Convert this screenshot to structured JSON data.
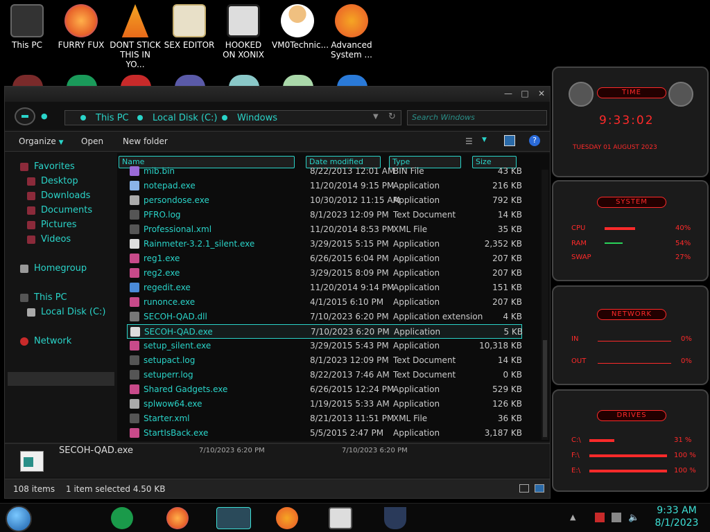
{
  "desktop": {
    "icons": [
      {
        "label": "This PC",
        "color": "#333"
      },
      {
        "label": "FURRY FUX",
        "color": "#e8642a"
      },
      {
        "label": "DONT STICK THIS IN YO...",
        "color": "#f5a623"
      },
      {
        "label": "SEX EDITOR",
        "color": "#c8b070"
      },
      {
        "label": "HOOKED ON XONIX",
        "color": "#888"
      },
      {
        "label": "VM0Technic...",
        "color": "#e89a3a"
      },
      {
        "label": "Advanced System ...",
        "color": "#f07a2a"
      }
    ]
  },
  "explorer": {
    "breadcrumbs": [
      "This PC",
      "Local Disk (C:)",
      "Windows"
    ],
    "search_placeholder": "Search Windows",
    "toolbar": {
      "organize": "Organize",
      "open": "Open",
      "new_folder": "New folder"
    },
    "nav": {
      "favorites": "Favorites",
      "desktop": "Desktop",
      "downloads": "Downloads",
      "documents": "Documents",
      "pictures": "Pictures",
      "videos": "Videos",
      "homegroup": "Homegroup",
      "this_pc": "This PC",
      "local_disk": "Local Disk (C:)",
      "network": "Network"
    },
    "columns": {
      "name": "Name",
      "date": "Date modified",
      "type": "Type",
      "size": "Size"
    },
    "files": [
      {
        "name": "mib.bin",
        "date": "8/22/2013 12:01 AM",
        "type": "BIN File",
        "size": "43 KB",
        "color": "#9a6ad8"
      },
      {
        "name": "notepad.exe",
        "date": "11/20/2014 9:15 PM",
        "type": "Application",
        "size": "216 KB",
        "color": "#8ab4e8"
      },
      {
        "name": "persondose.exe",
        "date": "10/30/2012 11:15 AM",
        "type": "Application",
        "size": "792 KB",
        "color": "#aaa"
      },
      {
        "name": "PFRO.log",
        "date": "8/1/2023 12:09 PM",
        "type": "Text Document",
        "size": "14 KB",
        "color": "#555"
      },
      {
        "name": "Professional.xml",
        "date": "11/20/2014 8:53 PM",
        "type": "XML File",
        "size": "35 KB",
        "color": "#555"
      },
      {
        "name": "Rainmeter-3.2.1_silent.exe",
        "date": "3/29/2015 5:15 PM",
        "type": "Application",
        "size": "2,352 KB",
        "color": "#ddd"
      },
      {
        "name": "reg1.exe",
        "date": "6/26/2015 6:04 PM",
        "type": "Application",
        "size": "207 KB",
        "color": "#c84a8a"
      },
      {
        "name": "reg2.exe",
        "date": "3/29/2015 8:09 PM",
        "type": "Application",
        "size": "207 KB",
        "color": "#c84a8a"
      },
      {
        "name": "regedit.exe",
        "date": "11/20/2014 9:14 PM",
        "type": "Application",
        "size": "151 KB",
        "color": "#4a8ad8"
      },
      {
        "name": "runonce.exe",
        "date": "4/1/2015 6:10 PM",
        "type": "Application",
        "size": "207 KB",
        "color": "#c84a8a"
      },
      {
        "name": "SECOH-QAD.dll",
        "date": "7/10/2023 6:20 PM",
        "type": "Application extension",
        "size": "4 KB",
        "color": "#777"
      },
      {
        "name": "SECOH-QAD.exe",
        "date": "7/10/2023 6:20 PM",
        "type": "Application",
        "size": "5 KB",
        "color": "#ddd"
      },
      {
        "name": "setup_silent.exe",
        "date": "3/29/2015 5:43 PM",
        "type": "Application",
        "size": "10,318 KB",
        "color": "#c84a8a"
      },
      {
        "name": "setupact.log",
        "date": "8/1/2023 12:09 PM",
        "type": "Text Document",
        "size": "14 KB",
        "color": "#555"
      },
      {
        "name": "setuperr.log",
        "date": "8/22/2013 7:46 AM",
        "type": "Text Document",
        "size": "0 KB",
        "color": "#555"
      },
      {
        "name": "Shared Gadgets.exe",
        "date": "6/26/2015 12:24 PM",
        "type": "Application",
        "size": "529 KB",
        "color": "#c84a8a"
      },
      {
        "name": "splwow64.exe",
        "date": "1/19/2015 5:33 AM",
        "type": "Application",
        "size": "126 KB",
        "color": "#aaa"
      },
      {
        "name": "Starter.xml",
        "date": "8/21/2013 11:51 PM",
        "type": "XML File",
        "size": "36 KB",
        "color": "#555"
      },
      {
        "name": "StartIsBack.exe",
        "date": "5/5/2015 2:47 PM",
        "type": "Application",
        "size": "3,187 KB",
        "color": "#c84a8a"
      }
    ],
    "details": {
      "name": "SECOH-QAD.exe",
      "date_modified": "7/10/2023 6:20 PM",
      "date_created": "7/10/2023 6:20 PM"
    },
    "status": {
      "count": "108 items",
      "selected": "1 item selected  4.50 KB"
    }
  },
  "gadgets": {
    "time": {
      "title": "TIME",
      "clock": "9:33:02",
      "date": "TUESDAY 01 AUGUST 2023"
    },
    "system": {
      "title": "SYSTEM",
      "rows": [
        {
          "label": "CPU",
          "value": "40%"
        },
        {
          "label": "RAM",
          "value": "54%"
        },
        {
          "label": "SWAP",
          "value": "27%"
        }
      ]
    },
    "network": {
      "title": "NETWORK",
      "rows": [
        {
          "label": "IN",
          "value": "0%"
        },
        {
          "label": "OUT",
          "value": "0%"
        }
      ]
    },
    "drives": {
      "title": "DRIVES",
      "rows": [
        {
          "label": "C:\\",
          "value": "31 %"
        },
        {
          "label": "F:\\",
          "value": "100 %"
        },
        {
          "label": "E:\\",
          "value": "100 %"
        }
      ]
    }
  },
  "taskbar": {
    "time": "9:33 AM",
    "date": "8/1/2023"
  }
}
